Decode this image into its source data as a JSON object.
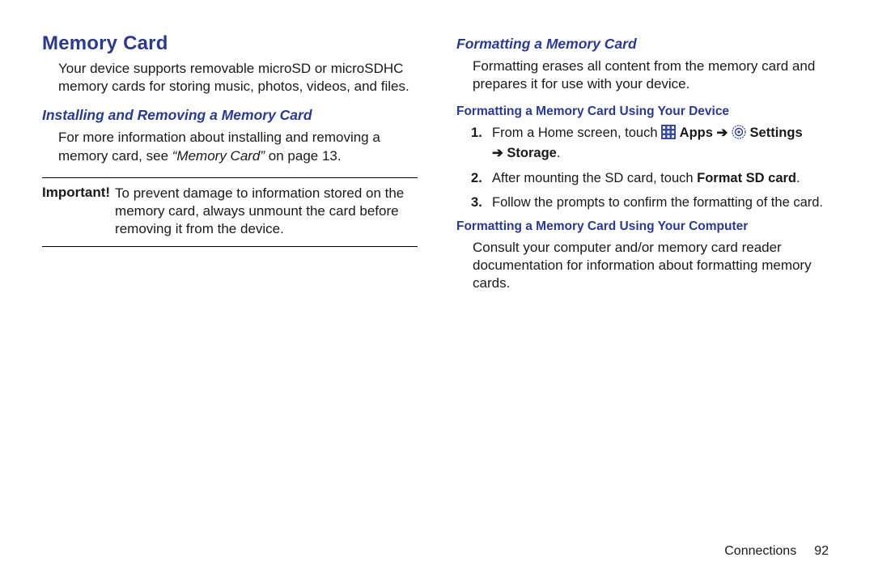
{
  "left": {
    "title": "Memory Card",
    "intro": "Your device supports removable microSD or microSDHC memory cards for storing music, photos, videos, and files.",
    "install_heading": "Installing and Removing a Memory Card",
    "install_pre": "For more information about installing and removing a memory card, see ",
    "install_ref": "“Memory Card”",
    "install_post": " on page 13.",
    "important_label": "Important!",
    "important_body": "To prevent damage to information stored on the memory card, always unmount the card before removing it from the device."
  },
  "right": {
    "format_heading": "Formatting a Memory Card",
    "format_intro": "Formatting erases all content from the memory card and prepares it for use with your device.",
    "using_device_heading": "Formatting a Memory Card Using Your Device",
    "step1_pre": "From a Home screen, touch ",
    "step1_apps": " Apps ",
    "step1_settings": " Settings ",
    "step1_storage": " Storage",
    "step1_dot": ".",
    "step2_pre": "After mounting the SD card, touch ",
    "step2_bold": "Format SD card",
    "step2_post": ".",
    "step3": "Follow the prompts to confirm the formatting of the card.",
    "using_computer_heading": "Formatting a Memory Card Using Your Computer",
    "computer_body": "Consult your computer and/or memory card reader documentation for information about formatting memory cards."
  },
  "footer": {
    "section": "Connections",
    "page": "92"
  }
}
